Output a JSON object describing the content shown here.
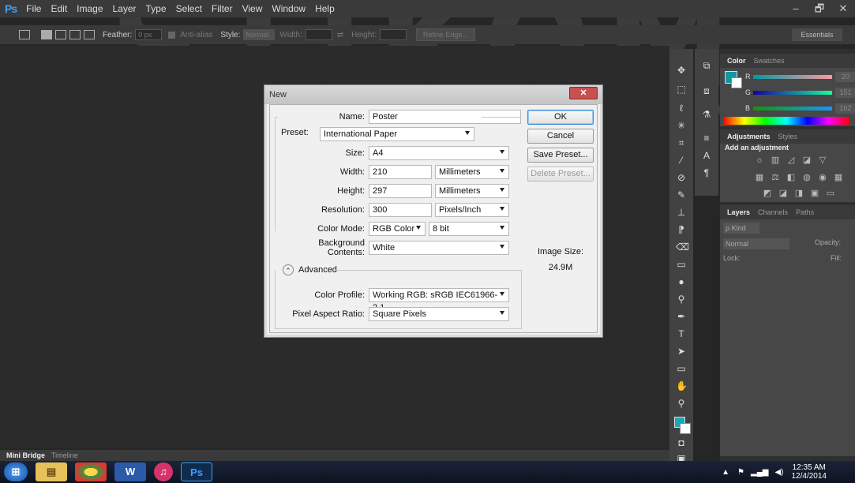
{
  "app": {
    "logo": "Ps",
    "menu": [
      "File",
      "Edit",
      "Image",
      "Layer",
      "Type",
      "Select",
      "Filter",
      "View",
      "Window",
      "Help"
    ],
    "window_controls": [
      "–",
      "🗗",
      "✕"
    ]
  },
  "watermark": {
    "text": "STIKOM",
    "sub": "SURABAYA"
  },
  "options_bar": {
    "feather_label": "Feather:",
    "feather_value": "0 px",
    "antialias_label": "Anti-alias",
    "style_label": "Style:",
    "style_value": "Normal",
    "width_label": "Width:",
    "height_label": "Height:",
    "refine_edge": "Refine Edge...",
    "workspace": "Essentials"
  },
  "dialog": {
    "title": "New",
    "close": "✕",
    "name_label": "Name:",
    "name_value": "Poster",
    "preset_label": "Preset:",
    "preset_value": "International Paper",
    "size_label": "Size:",
    "size_value": "A4",
    "width_label": "Width:",
    "width_value": "210",
    "width_unit": "Millimeters",
    "height_label": "Height:",
    "height_value": "297",
    "height_unit": "Millimeters",
    "resolution_label": "Resolution:",
    "resolution_value": "300",
    "resolution_unit": "Pixels/Inch",
    "color_mode_label": "Color Mode:",
    "color_mode_value": "RGB Color",
    "bit_depth": "8 bit",
    "bg_contents_label": "Background Contents:",
    "bg_contents_value": "White",
    "advanced_label": "Advanced",
    "advanced_toggle": "⌃",
    "color_profile_label": "Color Profile:",
    "color_profile_value": "Working RGB:  sRGB IEC61966-2.1",
    "pixel_aspect_label": "Pixel Aspect Ratio:",
    "pixel_aspect_value": "Square Pixels",
    "ok": "OK",
    "cancel": "Cancel",
    "save_preset": "Save Preset...",
    "delete_preset": "Delete Preset...",
    "image_size_label": "Image Size:",
    "image_size_value": "24.9M"
  },
  "color_panel": {
    "tabs": [
      "Color",
      "Swatches"
    ],
    "r_label": "R",
    "g_label": "G",
    "b_label": "B",
    "r_value": "20",
    "g_value": "151",
    "b_value": "162",
    "fg_color": "#1497a2"
  },
  "adjustments_panel": {
    "tabs": [
      "Adjustments",
      "Styles"
    ],
    "heading": "Add an adjustment"
  },
  "layers_panel": {
    "tabs": [
      "Layers",
      "Channels",
      "Paths"
    ],
    "kind_label": "ρ Kind",
    "blend_mode": "Normal",
    "opacity_label": "Opacity:",
    "lock_label": "Lock:",
    "fill_label": "Fill:"
  },
  "bottom_tabs": [
    "Mini Bridge",
    "Timeline"
  ],
  "taskbar": {
    "time": "12:35 AM",
    "date": "12/4/2014"
  }
}
